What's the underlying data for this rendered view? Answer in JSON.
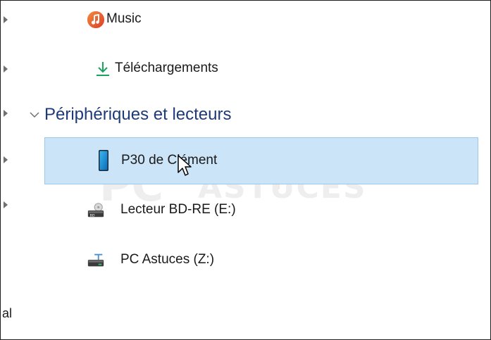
{
  "nav": {
    "items": [
      {
        "label": "Music",
        "icon": "music-icon"
      },
      {
        "label": "Téléchargements",
        "icon": "download-icon"
      }
    ],
    "section": {
      "label": "Périphériques et lecteurs",
      "icon": "chevron-down-icon"
    },
    "devices": [
      {
        "label": "P30 de Clément",
        "icon": "phone-icon",
        "selected": true
      },
      {
        "label": "Lecteur BD-RE (E:)",
        "icon": "bd-drive-icon",
        "selected": false
      },
      {
        "label": "PC Astuces (Z:)",
        "icon": "network-drive-icon",
        "selected": false
      }
    ],
    "partial_label": "al"
  },
  "watermark": {
    "text_pc": "PC",
    "text_astuces": "ASTUCES"
  },
  "colors": {
    "selection_bg": "#cce4f7",
    "selection_border": "#99c9ef",
    "section_text": "#1e3a78",
    "download_icon": "#1aa35b",
    "music_icon": "#e8672a"
  }
}
